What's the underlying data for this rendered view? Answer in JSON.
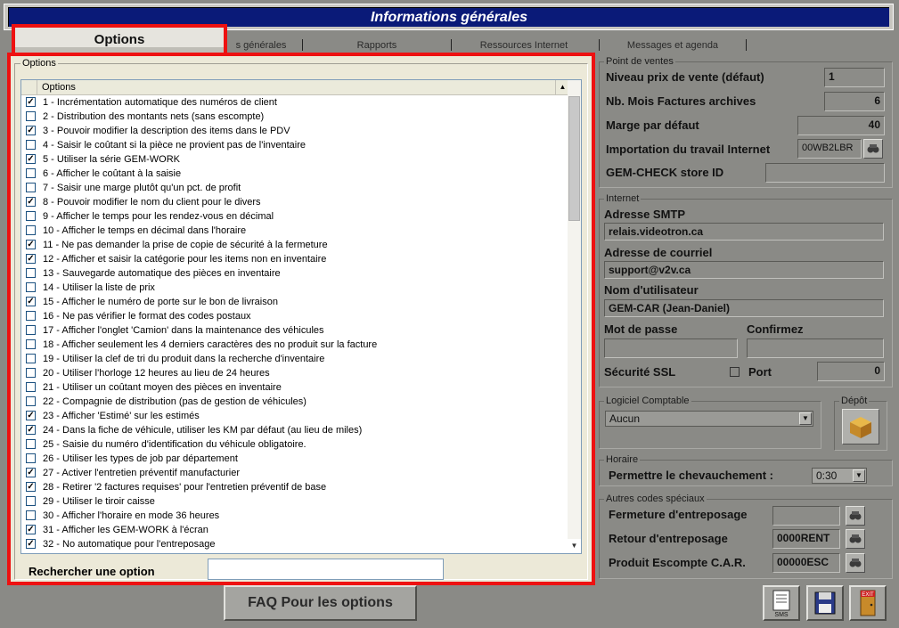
{
  "window": {
    "title": "Informations générales"
  },
  "tabs": [
    {
      "label": "Options",
      "active": true
    },
    {
      "label": "s générales"
    },
    {
      "label": "Rapports"
    },
    {
      "label": "Ressources Internet"
    },
    {
      "label": "Messages et agenda"
    }
  ],
  "options_panel": {
    "group_label": "Options",
    "column_header": "Options",
    "search_label": "Rechercher une option",
    "search_value": "",
    "items": [
      {
        "label": "1 - Incrémentation automatique des numéros de client",
        "checked": true
      },
      {
        "label": "2 - Distribution des montants nets (sans escompte)",
        "checked": false
      },
      {
        "label": "3 - Pouvoir modifier la description des items dans le PDV",
        "checked": true
      },
      {
        "label": "4 - Saisir le coûtant si la pièce ne provient pas de l'inventaire",
        "checked": false
      },
      {
        "label": "5 - Utiliser la série GEM-WORK",
        "checked": true
      },
      {
        "label": "6 - Afficher le coûtant à la saisie",
        "checked": false
      },
      {
        "label": "7 - Saisir une marge plutôt qu'un pct. de profit",
        "checked": false
      },
      {
        "label": "8 - Pouvoir modifier le nom du client pour le divers",
        "checked": true
      },
      {
        "label": "9 - Afficher le temps pour les rendez-vous en décimal",
        "checked": false
      },
      {
        "label": "10 - Afficher le temps en décimal dans l'horaire",
        "checked": false
      },
      {
        "label": "11 - Ne pas demander la prise de copie de sécurité à la fermeture",
        "checked": true
      },
      {
        "label": "12 - Afficher et saisir la catégorie pour les items non en inventaire",
        "checked": true
      },
      {
        "label": "13 - Sauvegarde automatique des pièces en inventaire",
        "checked": false
      },
      {
        "label": "14 - Utiliser la liste de prix",
        "checked": false
      },
      {
        "label": "15 - Afficher le numéro de porte sur le bon de livraison",
        "checked": true
      },
      {
        "label": "16 - Ne pas vérifier le format des codes postaux",
        "checked": false
      },
      {
        "label": "17 - Afficher l'onglet 'Camion' dans la maintenance des véhicules",
        "checked": false
      },
      {
        "label": "18 - Afficher seulement les 4 derniers caractères des no produit sur la facture",
        "checked": false
      },
      {
        "label": "19 - Utiliser la clef de tri du produit dans la recherche d'inventaire",
        "checked": false
      },
      {
        "label": "20 - Utiliser l'horloge 12 heures au lieu de 24 heures",
        "checked": false
      },
      {
        "label": "21 - Utiliser un coûtant moyen des pièces en inventaire",
        "checked": false
      },
      {
        "label": "22 - Compagnie de distribution (pas de gestion de véhicules)",
        "checked": false
      },
      {
        "label": "23 - Afficher 'Estimé' sur les estimés",
        "checked": true
      },
      {
        "label": "24 - Dans la fiche de véhicule, utiliser les KM par défaut (au lieu de miles)",
        "checked": true
      },
      {
        "label": "25 - Saisie du numéro d'identification du véhicule obligatoire.",
        "checked": false
      },
      {
        "label": "26 - Utiliser les types de job par département",
        "checked": false
      },
      {
        "label": "27 - Activer l'entretien préventif manufacturier",
        "checked": true
      },
      {
        "label": "28 - Retirer '2 factures requises' pour l'entretien préventif de base",
        "checked": true
      },
      {
        "label": "29 - Utiliser le tiroir caisse",
        "checked": false
      },
      {
        "label": "30 - Afficher l'horaire en mode 36 heures",
        "checked": false
      },
      {
        "label": "31 - Afficher les GEM-WORK à l'écran",
        "checked": true
      },
      {
        "label": "32 - No automatique pour l'entreposage",
        "checked": true
      }
    ]
  },
  "point_de_ventes": {
    "legend": "Point de ventes",
    "niveau_prix_label": "Niveau prix de vente (défaut)",
    "niveau_prix_value": "1",
    "nb_mois_label": "Nb. Mois Factures archives",
    "nb_mois_value": "6",
    "marge_label": "Marge par défaut",
    "marge_value": "40",
    "import_label": "Importation du travail Internet",
    "import_value": "00WB2LBR",
    "gemcheck_label": "GEM-CHECK store ID",
    "gemcheck_value": ""
  },
  "internet": {
    "legend": "Internet",
    "smtp_label": "Adresse SMTP",
    "smtp_value": "relais.videotron.ca",
    "email_label": "Adresse de courriel",
    "email_value": "support@v2v.ca",
    "user_label": "Nom d'utilisateur",
    "user_value": "GEM-CAR (Jean-Daniel)",
    "password_label": "Mot de passe",
    "confirm_label": "Confirmez",
    "ssl_label": "Sécurité  SSL",
    "port_label": "Port",
    "port_value": "0"
  },
  "logiciel": {
    "legend": "Logiciel Comptable",
    "value": "Aucun",
    "depot_label": "Dépôt"
  },
  "horaire": {
    "legend": "Horaire",
    "label": "Permettre le chevauchement :",
    "value": "0:30"
  },
  "autres": {
    "legend": "Autres codes spéciaux",
    "fermeture_label": "Fermeture d'entreposage",
    "fermeture_value": "",
    "retour_label": "Retour d'entreposage",
    "retour_value": "0000RENT",
    "produit_label": "Produit Escompte C.A.R.",
    "produit_value": "00000ESC"
  },
  "footer": {
    "faq_label": "FAQ Pour les options",
    "sms_label": "SMS",
    "exit_label": "EXIT"
  }
}
